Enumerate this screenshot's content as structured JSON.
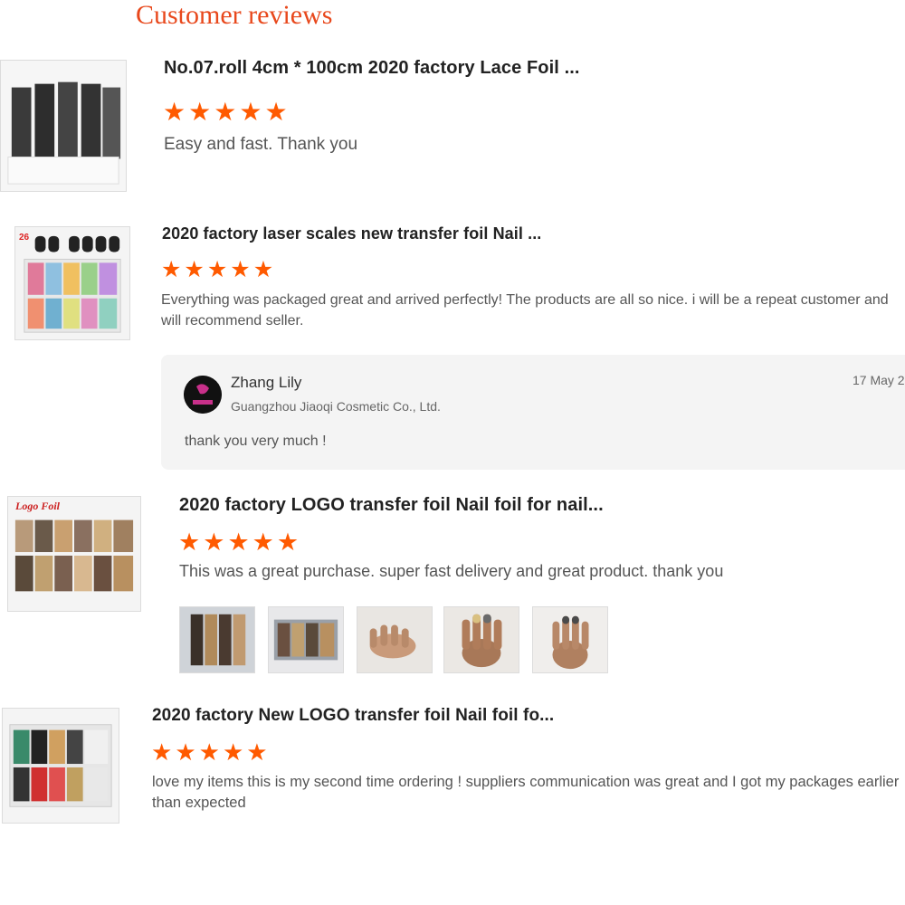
{
  "heading": "Customer reviews",
  "reviews": [
    {
      "title": "No.07.roll 4cm * 100cm 2020 factory Lace Foil ...",
      "rating": 5,
      "text": "Easy and fast. Thank you"
    },
    {
      "title": "2020 factory laser scales new transfer foil Nail ...",
      "rating": 5,
      "text": "Everything was packaged great and arrived perfectly!  The products are all so nice.  i will be a repeat customer and   will recommend seller.",
      "reply": {
        "name": "Zhang Lily",
        "company": "Guangzhou Jiaoqi Cosmetic Co., Ltd.",
        "date": "17 May 2",
        "text": "thank you very much !"
      }
    },
    {
      "title": "2020 factory LOGO transfer foil Nail foil for nail...",
      "rating": 5,
      "text": "This was a great purchase. super fast delivery and great product. thank you",
      "photo_count": 5
    },
    {
      "title": "2020 factory New LOGO transfer foil Nail foil fo...",
      "rating": 5,
      "text": "love my items this is my second time ordering ! suppliers communication was great and I got my packages earlier than expected"
    }
  ],
  "thumb_labels": {
    "review2": "26",
    "review3": "Logo Foil"
  },
  "colors": {
    "accent": "#e8481c",
    "star": "#ff5a00",
    "reply_bg": "#f4f4f4"
  }
}
